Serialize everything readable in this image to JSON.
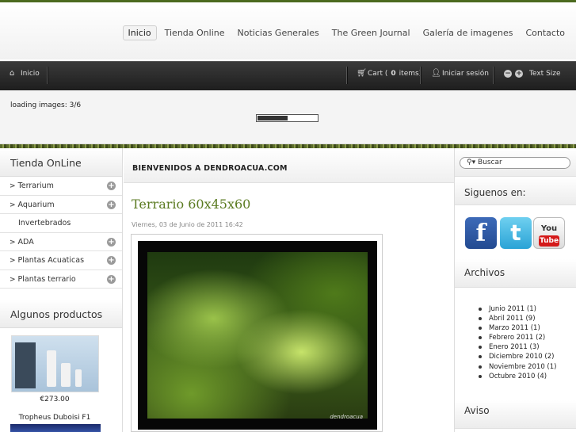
{
  "nav": {
    "items": [
      "Inicio",
      "Tienda Online",
      "Noticias Generales",
      "The Green Journal",
      "Galería de imagenes",
      "Contacto"
    ],
    "active": "Inicio"
  },
  "toolbar": {
    "home": "Inicio",
    "cart_prefix": "Cart (",
    "cart_count": "0",
    "cart_suffix": " items)",
    "login": "Iniciar sesión",
    "text_size": "Text Size",
    "decrease": "−",
    "increase": "+"
  },
  "loader": {
    "text": "loading images: 3/6",
    "progress": 0.5
  },
  "left": {
    "shop_title": "Tienda OnLine",
    "menu": [
      {
        "label": "Terrarium",
        "expandable": true,
        "arrow": true
      },
      {
        "label": "Aquarium",
        "expandable": true,
        "arrow": true
      },
      {
        "label": "Invertebrados",
        "expandable": false,
        "arrow": false
      },
      {
        "label": "ADA",
        "expandable": true,
        "arrow": true
      },
      {
        "label": "Plantas Acuaticas",
        "expandable": true,
        "arrow": true
      },
      {
        "label": "Plantas terrario",
        "expandable": true,
        "arrow": true
      }
    ],
    "products_title": "Algunos productos",
    "product_price": "€273.00",
    "product2_name": "Tropheus Duboisi F1"
  },
  "main": {
    "welcome": "BIENVENIDOS A DENDROACUA.COM",
    "article_title": "Terrario 60x45x60",
    "article_date": "Viernes, 03 de Junio de 2011 16:42",
    "image_watermark": "dendroacua"
  },
  "right": {
    "search_placeholder": "Buscar",
    "follow_title": "Siguenos en:",
    "social": [
      "facebook-icon",
      "twitter-icon",
      "youtube-icon"
    ],
    "youtube_you": "You",
    "youtube_tube": "Tube",
    "archive_title": "Archivos",
    "archive": [
      "Junio 2011 (1)",
      "Abril 2011 (9)",
      "Marzo 2011 (1)",
      "Febrero 2011 (2)",
      "Enero 2011 (3)",
      "Diciembre 2010 (2)",
      "Noviembre 2010 (1)",
      "Octubre 2010 (4)"
    ],
    "notice_title": "Aviso"
  },
  "colors": {
    "brand_green": "#5a7a20",
    "toolbar_dark": "#1e1e1e"
  }
}
